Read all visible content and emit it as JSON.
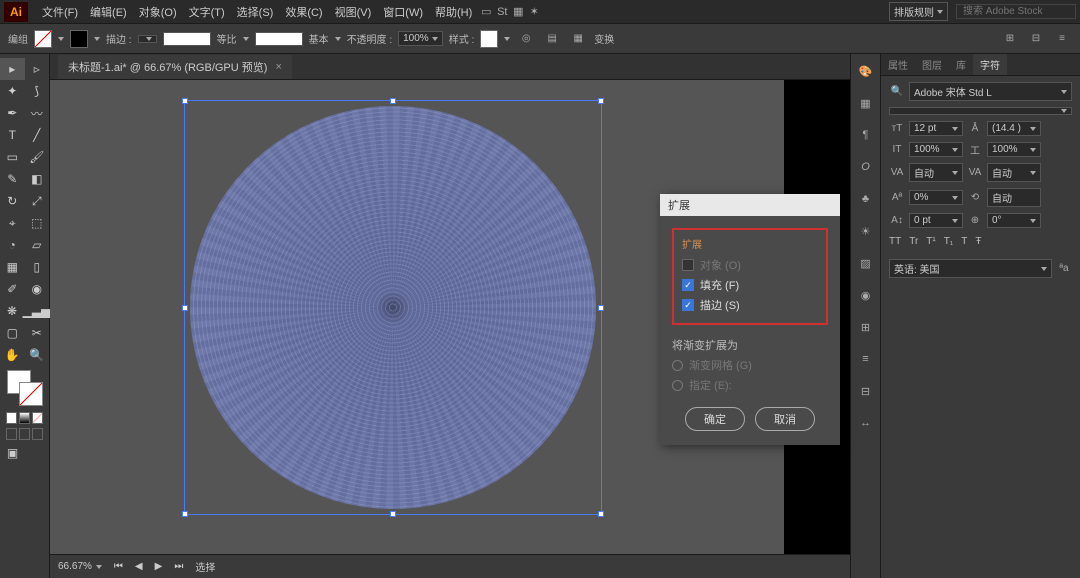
{
  "menubar": {
    "items": [
      "文件(F)",
      "编辑(E)",
      "对象(O)",
      "文字(T)",
      "选择(S)",
      "效果(C)",
      "视图(V)",
      "窗口(W)",
      "帮助(H)"
    ],
    "workspace": "排版规则",
    "search_placeholder": "搜索 Adobe Stock"
  },
  "controlbar": {
    "group_label": "编组",
    "stroke_label": "描边 :",
    "stroke_weight": "",
    "dash_label": "等比",
    "profile_label": "基本",
    "opacity_label": "不透明度 :",
    "opacity_value": "100%",
    "style_label": "样式 :",
    "transform_label": "变换"
  },
  "document": {
    "tab_title": "未标题-1.ai* @ 66.67% (RGB/GPU 预览)"
  },
  "statusbar": {
    "zoom": "66.67%",
    "tool": "选择"
  },
  "dialog": {
    "title": "扩展",
    "section": "扩展",
    "opt_object": "对象 (O)",
    "opt_fill": "填充 (F)",
    "opt_stroke": "描边 (S)",
    "gradient_header": "将渐变扩展为",
    "opt_mesh": "渐变网格 (G)",
    "opt_specify": "指定 (E):",
    "ok": "确定",
    "cancel": "取消"
  },
  "char_panel": {
    "tabs": [
      "属性",
      "图层",
      "库",
      "字符"
    ],
    "font": "Adobe 宋体 Std L",
    "font_style": "",
    "size": "12 pt",
    "leading": "(14.4 )",
    "tracking_h": "100%",
    "tracking_v": "100%",
    "kerning": "自动",
    "metrics": "自动",
    "baseline": "0%",
    "rotate": "自动",
    "shift": "0 pt",
    "rotation": "0°",
    "tt_row": [
      "TT",
      "Tr",
      "T¹",
      "T₁",
      "T",
      "Ŧ"
    ],
    "language": "英语: 美国",
    "aa": "ªa"
  }
}
